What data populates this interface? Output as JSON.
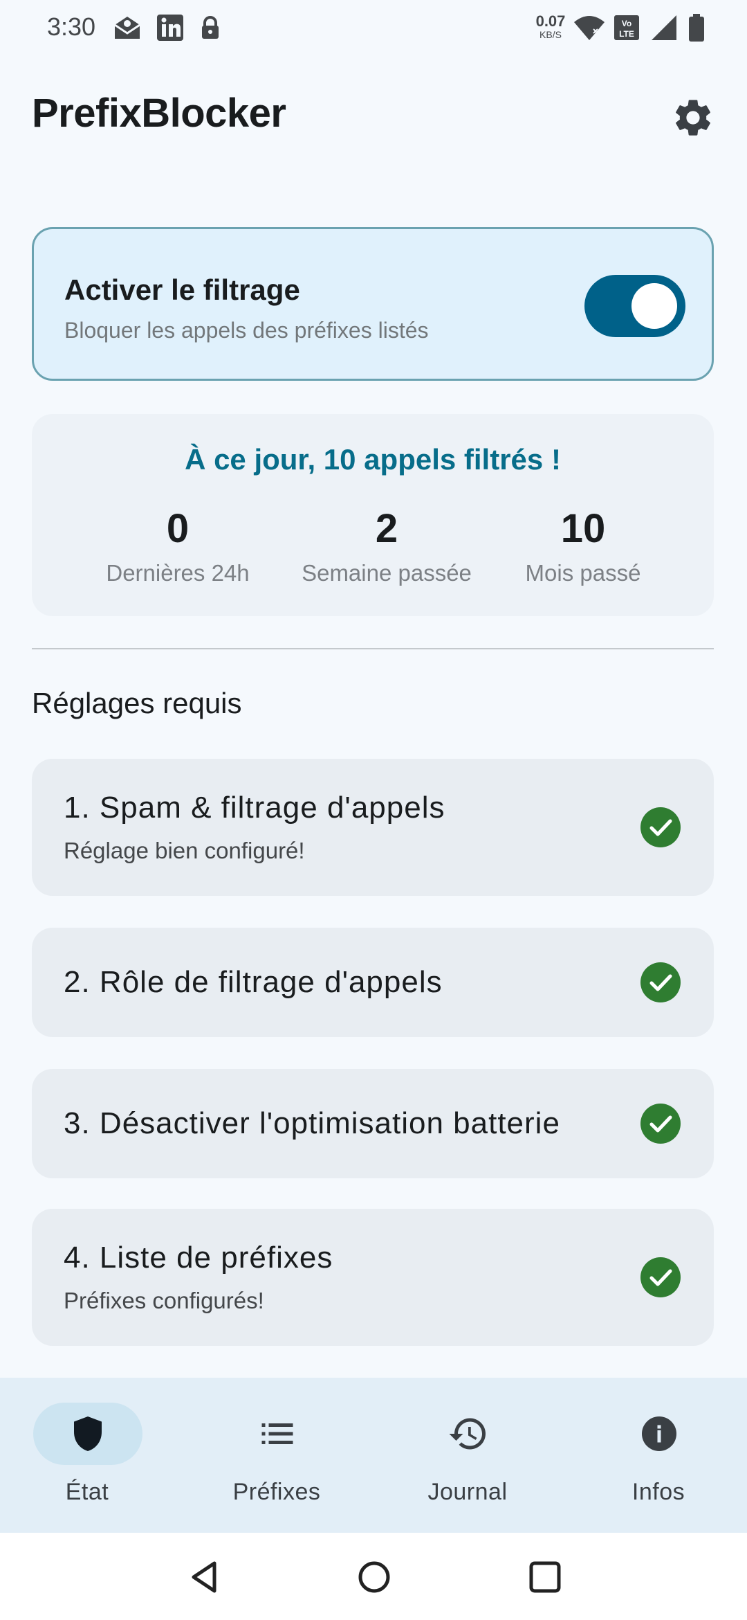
{
  "status_bar": {
    "time": "3:30",
    "icons_left": [
      "mail-notification-icon",
      "linkedin-icon",
      "lock-icon"
    ],
    "net_speed_value": "0.07",
    "net_speed_unit": "KB/S",
    "icons_right": [
      "wifi-icon",
      "volte-icon",
      "cell-signal-icon",
      "battery-icon"
    ]
  },
  "app_bar": {
    "title": "PrefixBlocker",
    "settings_icon": "gear-icon"
  },
  "filter": {
    "title": "Activer le filtrage",
    "subtitle": "Bloquer les appels des préfixes listés",
    "enabled": true
  },
  "stats": {
    "headline": "À ce jour, 10 appels filtrés !",
    "items": [
      {
        "value": "0",
        "label": "Dernières 24h"
      },
      {
        "value": "2",
        "label": "Semaine passée"
      },
      {
        "value": "10",
        "label": "Mois passé"
      }
    ]
  },
  "settings": {
    "title": "Réglages requis",
    "items": [
      {
        "title": "1. Spam & filtrage d'appels",
        "subtitle": "Réglage bien configuré!",
        "done": true
      },
      {
        "title": "2. Rôle de filtrage d'appels",
        "subtitle": "",
        "done": true
      },
      {
        "title": "3. Désactiver l'optimisation batterie",
        "subtitle": "",
        "done": true
      },
      {
        "title": "4. Liste de préfixes",
        "subtitle": "Préfixes configurés!",
        "done": true
      }
    ]
  },
  "bottom_nav": {
    "items": [
      {
        "label": "État",
        "icon": "shield-icon",
        "active": true
      },
      {
        "label": "Préfixes",
        "icon": "list-icon",
        "active": false
      },
      {
        "label": "Journal",
        "icon": "history-icon",
        "active": false
      },
      {
        "label": "Infos",
        "icon": "info-icon",
        "active": false
      }
    ]
  },
  "system_nav": [
    "back-icon",
    "home-icon",
    "recents-icon"
  ],
  "colors": {
    "primary": "#006189",
    "headline": "#076d8a",
    "success": "#2f7d31",
    "background": "#f5f9fd"
  }
}
